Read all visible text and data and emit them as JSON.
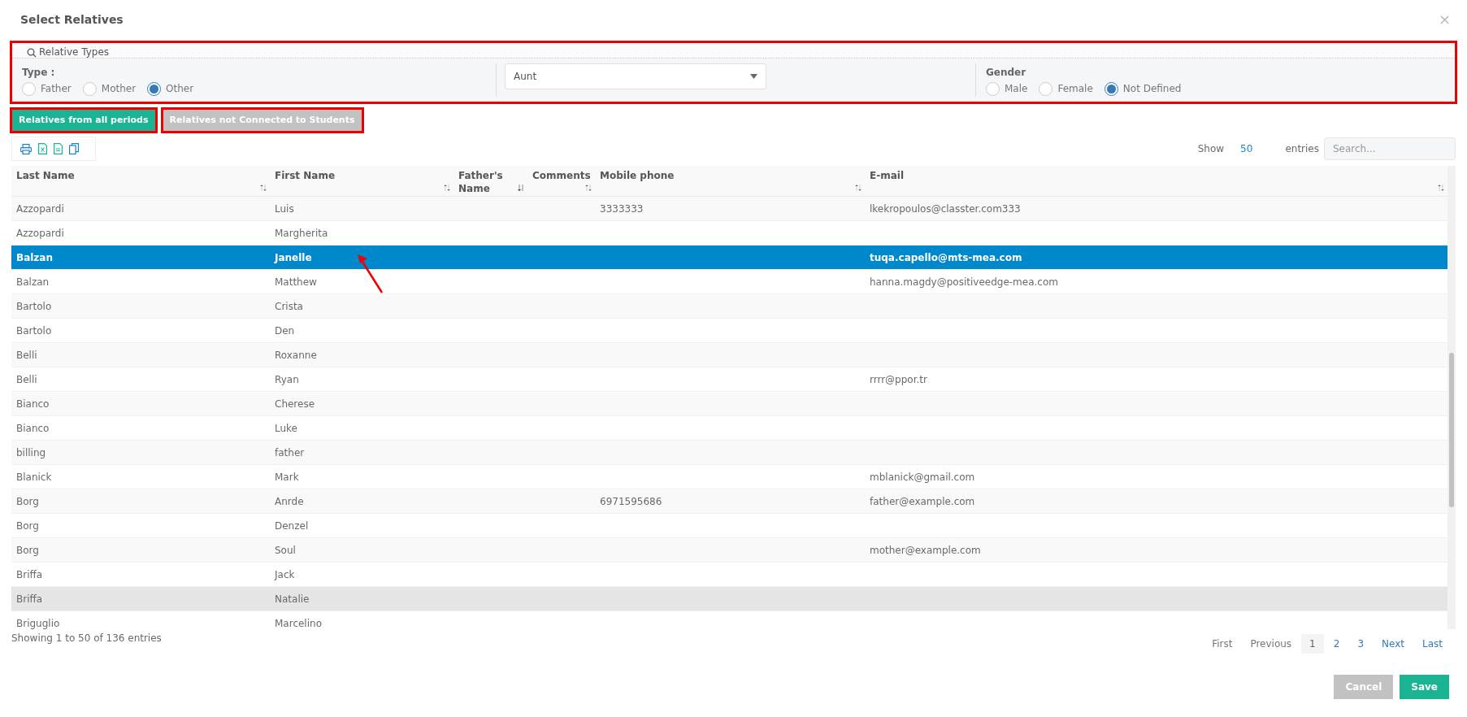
{
  "dialog": {
    "title": "Select Relatives",
    "close": "×"
  },
  "filters": {
    "legend": "Relative Types",
    "type_label": "Type :",
    "types": [
      {
        "label": "Father",
        "selected": false
      },
      {
        "label": "Mother",
        "selected": false
      },
      {
        "label": "Other",
        "selected": true
      }
    ],
    "relation": {
      "value": "Aunt"
    },
    "gender_label": "Gender",
    "genders": [
      {
        "label": "Male",
        "selected": false
      },
      {
        "label": "Female",
        "selected": false
      },
      {
        "label": "Not Defined",
        "selected": true
      }
    ]
  },
  "action_buttons": [
    {
      "label": "Relatives from all periods",
      "kind": "primary"
    },
    {
      "label": "Relatives not Connected to Students",
      "kind": "secondary"
    }
  ],
  "length": {
    "show": "Show",
    "value": "50",
    "entries": "entries"
  },
  "search": {
    "placeholder": "Search..."
  },
  "table": {
    "columns": [
      {
        "label": "Last Name",
        "sorted": false
      },
      {
        "label": "First Name",
        "sorted": false
      },
      {
        "label": "Father's Name",
        "sorted": true
      },
      {
        "label": "Comments",
        "sorted": false
      },
      {
        "label": "Mobile phone",
        "sorted": false
      },
      {
        "label": "E-mail",
        "sorted": false
      }
    ],
    "rows": [
      {
        "cells": [
          "Azzopardi",
          "Luis",
          "",
          "",
          "3333333",
          "lkekropoulos@classter.com333"
        ],
        "selected": false,
        "highlighted": false
      },
      {
        "cells": [
          "Azzopardi",
          "Margherita",
          "",
          "",
          "",
          ""
        ],
        "selected": false,
        "highlighted": false
      },
      {
        "cells": [
          "Balzan",
          "Janelle",
          "",
          "",
          "",
          "tuqa.capello@mts-mea.com"
        ],
        "selected": true,
        "highlighted": false
      },
      {
        "cells": [
          "Balzan",
          "Matthew",
          "",
          "",
          "",
          "hanna.magdy@positiveedge-mea.com"
        ],
        "selected": false,
        "highlighted": false
      },
      {
        "cells": [
          "Bartolo",
          "Crista",
          "",
          "",
          "",
          ""
        ],
        "selected": false,
        "highlighted": false
      },
      {
        "cells": [
          "Bartolo",
          "Den",
          "",
          "",
          "",
          ""
        ],
        "selected": false,
        "highlighted": false
      },
      {
        "cells": [
          "Belli",
          "Roxanne",
          "",
          "",
          "",
          ""
        ],
        "selected": false,
        "highlighted": false
      },
      {
        "cells": [
          "Belli",
          "Ryan",
          "",
          "",
          "",
          "rrrr@ppor.tr"
        ],
        "selected": false,
        "highlighted": false
      },
      {
        "cells": [
          "Bianco",
          "Cherese",
          "",
          "",
          "",
          ""
        ],
        "selected": false,
        "highlighted": false
      },
      {
        "cells": [
          "Bianco",
          "Luke",
          "",
          "",
          "",
          ""
        ],
        "selected": false,
        "highlighted": false
      },
      {
        "cells": [
          "billing",
          "father",
          "",
          "",
          "",
          ""
        ],
        "selected": false,
        "highlighted": false
      },
      {
        "cells": [
          "Blanick",
          "Mark",
          "",
          "",
          "",
          "mblanick@gmail.com"
        ],
        "selected": false,
        "highlighted": false
      },
      {
        "cells": [
          "Borg",
          "Anrde",
          "",
          "",
          "6971595686",
          "father@example.com"
        ],
        "selected": false,
        "highlighted": false
      },
      {
        "cells": [
          "Borg",
          "Denzel",
          "",
          "",
          "",
          ""
        ],
        "selected": false,
        "highlighted": false
      },
      {
        "cells": [
          "Borg",
          "Soul",
          "",
          "",
          "",
          "mother@example.com"
        ],
        "selected": false,
        "highlighted": false
      },
      {
        "cells": [
          "Briffa",
          "Jack",
          "",
          "",
          "",
          ""
        ],
        "selected": false,
        "highlighted": false
      },
      {
        "cells": [
          "Briffa",
          "Natalie",
          "",
          "",
          "",
          ""
        ],
        "selected": false,
        "highlighted": true
      },
      {
        "cells": [
          "Briguglio",
          "Marcelino",
          "",
          "",
          "",
          ""
        ],
        "selected": false,
        "highlighted": false
      }
    ]
  },
  "info": "Showing 1 to 50 of 136 entries",
  "pagination": [
    {
      "label": "First",
      "disabled": true,
      "selected": false
    },
    {
      "label": "Previous",
      "disabled": true,
      "selected": false
    },
    {
      "label": "1",
      "disabled": false,
      "selected": true
    },
    {
      "label": "2",
      "disabled": false,
      "selected": false
    },
    {
      "label": "3",
      "disabled": false,
      "selected": false
    },
    {
      "label": "Next",
      "disabled": false,
      "selected": false
    },
    {
      "label": "Last",
      "disabled": false,
      "selected": false
    }
  ],
  "footer_buttons": [
    {
      "label": "Cancel",
      "kind": "secondary"
    },
    {
      "label": "Save",
      "kind": "primary"
    }
  ]
}
